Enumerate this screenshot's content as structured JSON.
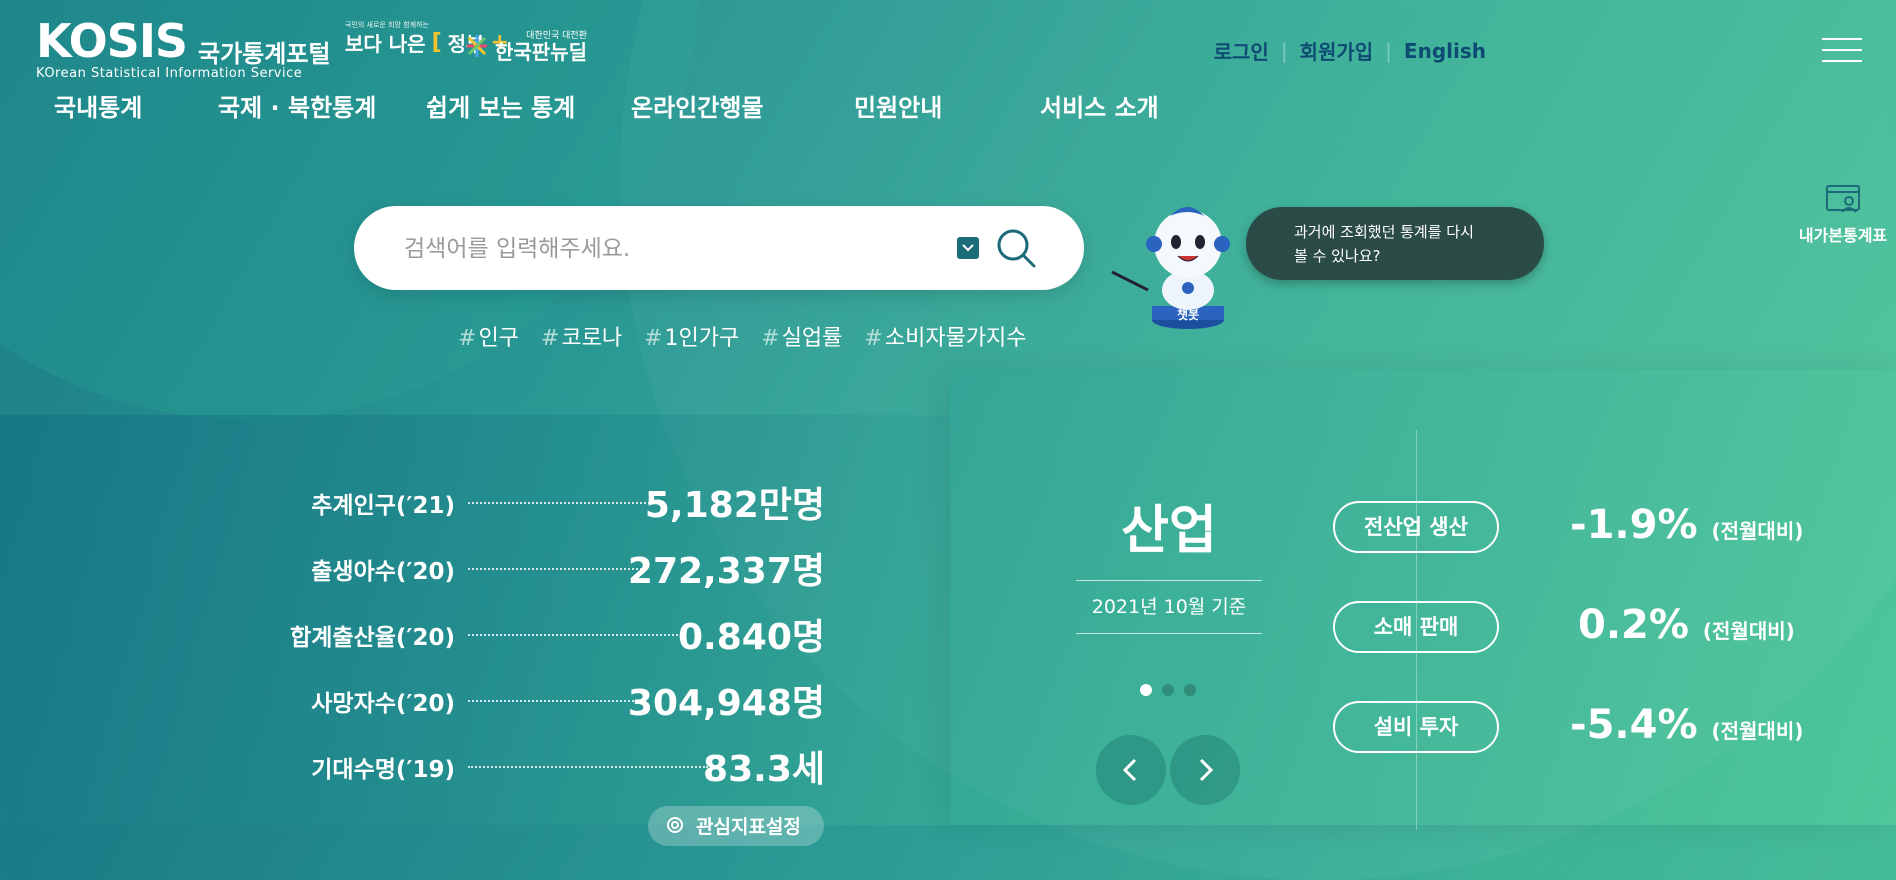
{
  "header": {
    "logo": "KOSIS",
    "logo_kr": "국가통계포털",
    "logo_sub": "KOrean Statistical Information Service",
    "gov_small": "국민의 새로운 희망 함께하는",
    "gov_text_a": "보다 나은",
    "gov_text_b": "정부",
    "newdeal_small": "대한민국 대전환",
    "newdeal_text": "한국판뉴딜"
  },
  "util": {
    "login": "로그인",
    "signup": "회원가입",
    "english": "English"
  },
  "gnb": [
    "국내통계",
    "국제 · 북한통계",
    "쉽게 보는 통계",
    "온라인간행물",
    "민원안내",
    "서비스 소개"
  ],
  "search": {
    "placeholder": "검색어를 입력해주세요."
  },
  "tags": [
    "인구",
    "코로나",
    "1인가구",
    "실업률",
    "소비자물가지수"
  ],
  "chatbot": {
    "label": "챗봇",
    "bubble_line1": "과거에 조회했던 통계를 다시",
    "bubble_line2": "볼 수 있나요?"
  },
  "mytable": {
    "label": "내가본통계표"
  },
  "stats": [
    {
      "label": "추계인구(′21)",
      "value": "5,182만명"
    },
    {
      "label": "출생아수(′20)",
      "value": "272,337명"
    },
    {
      "label": "합계출산율(′20)",
      "value": "0.840명"
    },
    {
      "label": "사망자수(′20)",
      "value": "304,948명"
    },
    {
      "label": "기대수명(′19)",
      "value": "83.3세"
    }
  ],
  "interest": {
    "label": "관심지표설정"
  },
  "industry": {
    "title": "산업",
    "date": "2021년 10월 기준",
    "items": [
      {
        "label": "전산업 생산",
        "value": "-1.9%",
        "unit": "(전월대비)"
      },
      {
        "label": "소매 판매",
        "value": "0.2%",
        "unit": "(전월대비)"
      },
      {
        "label": "설비 투자",
        "value": "-5.4%",
        "unit": "(전월대비)"
      }
    ]
  },
  "colors": {
    "accent": "#0e4b73",
    "bubble": "#2b4b46",
    "dropdown": "#1b6b78"
  }
}
